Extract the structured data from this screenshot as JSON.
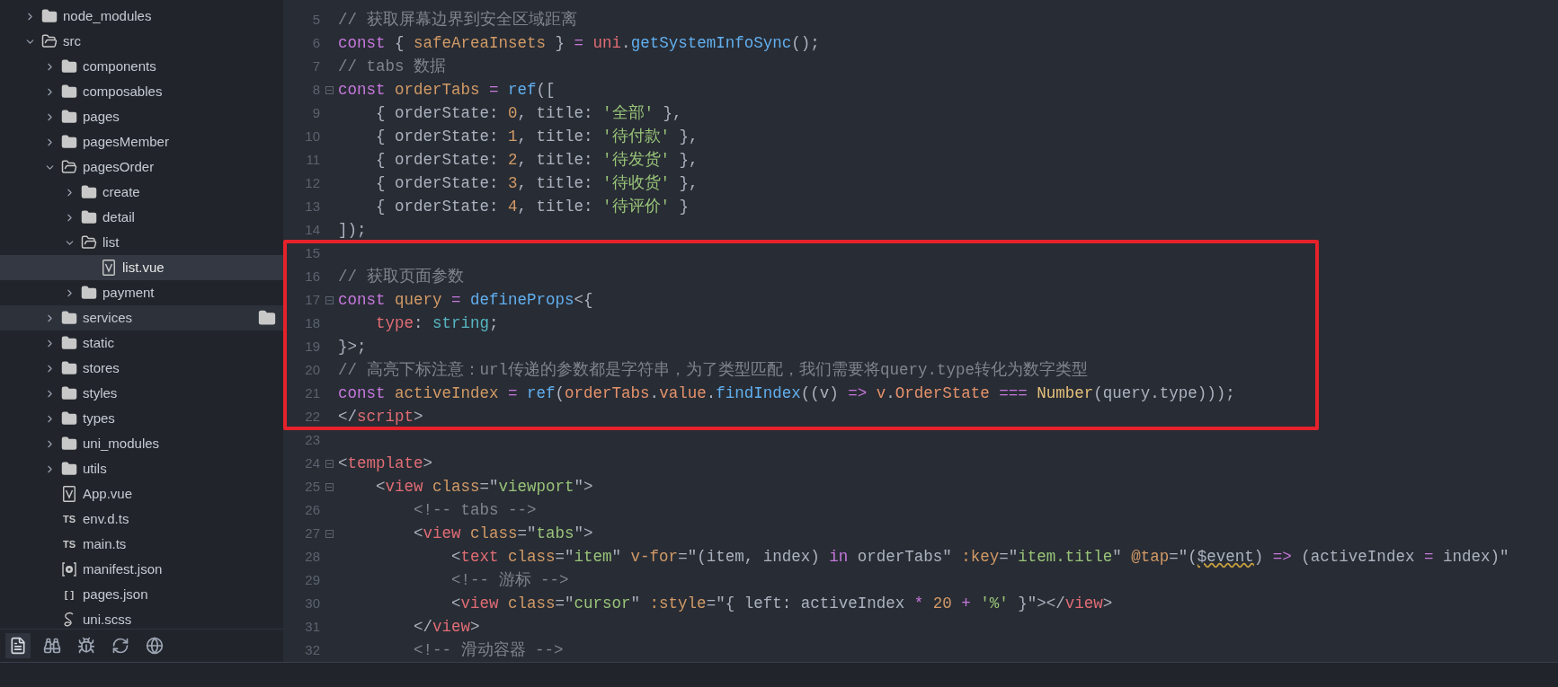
{
  "tree": [
    {
      "kind": "folder",
      "label": "node_modules",
      "expanded": false,
      "selected": false,
      "hovered": false
    },
    {
      "kind": "folder",
      "label": "src",
      "expanded": true,
      "selected": false,
      "hovered": false,
      "children": [
        {
          "kind": "folder",
          "label": "components",
          "expanded": false,
          "selected": false,
          "hovered": false
        },
        {
          "kind": "folder",
          "label": "composables",
          "expanded": false,
          "selected": false,
          "hovered": false
        },
        {
          "kind": "folder",
          "label": "pages",
          "expanded": false,
          "selected": false,
          "hovered": false
        },
        {
          "kind": "folder",
          "label": "pagesMember",
          "expanded": false,
          "selected": false,
          "hovered": false
        },
        {
          "kind": "folder",
          "label": "pagesOrder",
          "expanded": true,
          "selected": false,
          "hovered": false,
          "children": [
            {
              "kind": "folder",
              "label": "create",
              "expanded": false,
              "selected": false,
              "hovered": false
            },
            {
              "kind": "folder",
              "label": "detail",
              "expanded": false,
              "selected": false,
              "hovered": false
            },
            {
              "kind": "folder",
              "label": "list",
              "expanded": true,
              "selected": false,
              "hovered": false,
              "children": [
                {
                  "kind": "vue",
                  "label": "list.vue",
                  "selected": true,
                  "hovered": false
                }
              ]
            },
            {
              "kind": "folder",
              "label": "payment",
              "expanded": false,
              "selected": false,
              "hovered": false
            }
          ]
        },
        {
          "kind": "folder",
          "label": "services",
          "expanded": false,
          "selected": false,
          "hovered": true
        },
        {
          "kind": "folder",
          "label": "static",
          "expanded": false,
          "selected": false,
          "hovered": false
        },
        {
          "kind": "folder",
          "label": "stores",
          "expanded": false,
          "selected": false,
          "hovered": false
        },
        {
          "kind": "folder",
          "label": "styles",
          "expanded": false,
          "selected": false,
          "hovered": false
        },
        {
          "kind": "folder",
          "label": "types",
          "expanded": false,
          "selected": false,
          "hovered": false
        },
        {
          "kind": "folder",
          "label": "uni_modules",
          "expanded": false,
          "selected": false,
          "hovered": false
        },
        {
          "kind": "folder",
          "label": "utils",
          "expanded": false,
          "selected": false,
          "hovered": false
        },
        {
          "kind": "vue",
          "label": "App.vue",
          "selected": false,
          "hovered": false
        },
        {
          "kind": "labelled",
          "icon_text": "TS",
          "label": "env.d.ts",
          "selected": false,
          "hovered": false
        },
        {
          "kind": "labelled",
          "icon_text": "TS",
          "label": "main.ts",
          "selected": false,
          "hovered": false
        },
        {
          "kind": "settings",
          "label": "manifest.json",
          "selected": false,
          "hovered": false
        },
        {
          "kind": "labelled",
          "icon_text": "[ ]",
          "label": "pages.json",
          "selected": false,
          "hovered": false
        },
        {
          "kind": "style",
          "label": "uni.scss",
          "selected": false,
          "hovered": false
        }
      ]
    }
  ],
  "toolbar": [
    {
      "selected": true
    },
    {
      "selected": false
    },
    {
      "selected": false
    },
    {
      "selected": false
    },
    {
      "selected": false
    }
  ],
  "code_blocks": [
    {
      "boxed": false,
      "lines": [
        {
          "number": "5",
          "foldable": false,
          "tokens": [
            {
              "kind": "comment",
              "text": "// 获取屏幕边界到安全区域距离"
            }
          ]
        },
        {
          "number": "6",
          "foldable": false,
          "tokens": [
            {
              "kind": "kw",
              "text": "const"
            },
            {
              "kind": "plain",
              "text": " { "
            },
            {
              "kind": "var",
              "text": "safeAreaInsets"
            },
            {
              "kind": "plain",
              "text": " } "
            },
            {
              "kind": "op",
              "text": "= "
            },
            {
              "kind": "obj",
              "text": "uni"
            },
            {
              "kind": "plain",
              "text": "."
            },
            {
              "kind": "fn",
              "text": "getSystemInfoSync"
            },
            {
              "kind": "plain",
              "text": "();"
            }
          ]
        },
        {
          "number": "7",
          "foldable": false,
          "tokens": [
            {
              "kind": "comment",
              "text": "// tabs 数据"
            }
          ]
        },
        {
          "number": "8",
          "foldable": true,
          "tokens": [
            {
              "kind": "kw",
              "text": "const "
            },
            {
              "kind": "var",
              "text": "orderTabs "
            },
            {
              "kind": "op",
              "text": "= "
            },
            {
              "kind": "fn",
              "text": "ref"
            },
            {
              "kind": "plain",
              "text": "(["
            }
          ]
        },
        {
          "number": "9",
          "foldable": false,
          "tokens": [
            {
              "kind": "plain",
              "text": "    { orderState: "
            },
            {
              "kind": "num",
              "text": "0"
            },
            {
              "kind": "plain",
              "text": ", title: "
            },
            {
              "kind": "str",
              "text": "'全部'"
            },
            {
              "kind": "plain",
              "text": " },"
            }
          ]
        },
        {
          "number": "10",
          "foldable": false,
          "tokens": [
            {
              "kind": "plain",
              "text": "    { orderState: "
            },
            {
              "kind": "num",
              "text": "1"
            },
            {
              "kind": "plain",
              "text": ", title: "
            },
            {
              "kind": "str",
              "text": "'待付款'"
            },
            {
              "kind": "plain",
              "text": " },"
            }
          ]
        },
        {
          "number": "11",
          "foldable": false,
          "tokens": [
            {
              "kind": "plain",
              "text": "    { orderState: "
            },
            {
              "kind": "num",
              "text": "2"
            },
            {
              "kind": "plain",
              "text": ", title: "
            },
            {
              "kind": "str",
              "text": "'待发货'"
            },
            {
              "kind": "plain",
              "text": " },"
            }
          ]
        },
        {
          "number": "12",
          "foldable": false,
          "tokens": [
            {
              "kind": "plain",
              "text": "    { orderState: "
            },
            {
              "kind": "num",
              "text": "3"
            },
            {
              "kind": "plain",
              "text": ", title: "
            },
            {
              "kind": "str",
              "text": "'待收货'"
            },
            {
              "kind": "plain",
              "text": " },"
            }
          ]
        },
        {
          "number": "13",
          "foldable": false,
          "tokens": [
            {
              "kind": "plain",
              "text": "    { orderState: "
            },
            {
              "kind": "num",
              "text": "4"
            },
            {
              "kind": "plain",
              "text": ", title: "
            },
            {
              "kind": "str",
              "text": "'待评价'"
            },
            {
              "kind": "plain",
              "text": " }"
            }
          ]
        },
        {
          "number": "14",
          "foldable": false,
          "tokens": [
            {
              "kind": "plain",
              "text": "]);"
            }
          ]
        }
      ]
    },
    {
      "boxed": true,
      "lines": [
        {
          "number": "15",
          "foldable": false
        },
        {
          "number": "16",
          "foldable": false,
          "tokens": [
            {
              "kind": "comment",
              "text": "// 获取页面参数"
            }
          ]
        },
        {
          "number": "17",
          "foldable": true,
          "tokens": [
            {
              "kind": "kw",
              "text": "const "
            },
            {
              "kind": "var",
              "text": "query "
            },
            {
              "kind": "op",
              "text": "= "
            },
            {
              "kind": "fn",
              "text": "defineProps"
            },
            {
              "kind": "plain",
              "text": "<{"
            }
          ]
        },
        {
          "number": "18",
          "foldable": false,
          "tokens": [
            {
              "kind": "prop",
              "text": "    type"
            },
            {
              "kind": "plain",
              "text": ": "
            },
            {
              "kind": "type",
              "text": "string"
            },
            {
              "kind": "plain",
              "text": ";"
            }
          ]
        },
        {
          "number": "19",
          "foldable": false,
          "tokens": [
            {
              "kind": "plain",
              "text": "}>;"
            }
          ]
        },
        {
          "number": "20",
          "foldable": false,
          "tokens": [
            {
              "kind": "comment",
              "text": "// 高亮下标注意：url传递的参数都是字符串，为了类型匹配，我们需要将query.type转化为数字类型"
            }
          ]
        },
        {
          "number": "21",
          "foldable": false,
          "tokens": [
            {
              "kind": "kw",
              "text": "const "
            },
            {
              "kind": "var",
              "text": "activeIndex "
            },
            {
              "kind": "op",
              "text": "= "
            },
            {
              "kind": "fn",
              "text": "ref"
            },
            {
              "kind": "plain",
              "text": "("
            },
            {
              "kind": "ident",
              "text": "orderTabs"
            },
            {
              "kind": "plain",
              "text": "."
            },
            {
              "kind": "ident",
              "text": "value"
            },
            {
              "kind": "plain",
              "text": "."
            },
            {
              "kind": "fn",
              "text": "findIndex"
            },
            {
              "kind": "plain",
              "text": "((v) "
            },
            {
              "kind": "op",
              "text": "=> "
            },
            {
              "kind": "ident",
              "text": "v"
            },
            {
              "kind": "plain",
              "text": "."
            },
            {
              "kind": "ident",
              "text": "OrderState "
            },
            {
              "kind": "op",
              "text": "=== "
            },
            {
              "kind": "cls",
              "text": "Number"
            },
            {
              "kind": "plain",
              "text": "(query.type)));"
            }
          ]
        },
        {
          "number": "22",
          "foldable": false,
          "tokens": [
            {
              "kind": "plain",
              "text": "</"
            },
            {
              "kind": "tag",
              "text": "script"
            },
            {
              "kind": "plain",
              "text": ">"
            }
          ]
        }
      ]
    },
    {
      "boxed": false,
      "lines": [
        {
          "number": "23",
          "foldable": false
        },
        {
          "number": "24",
          "foldable": true,
          "tokens": [
            {
              "kind": "plain",
              "text": "<"
            },
            {
              "kind": "tag",
              "text": "template"
            },
            {
              "kind": "plain",
              "text": ">"
            }
          ]
        },
        {
          "number": "25",
          "foldable": true,
          "tokens": [
            {
              "kind": "plain",
              "text": "    <"
            },
            {
              "kind": "tag",
              "text": "view "
            },
            {
              "kind": "attr",
              "text": "class"
            },
            {
              "kind": "plain",
              "text": "=\""
            },
            {
              "kind": "str",
              "text": "viewport"
            },
            {
              "kind": "plain",
              "text": "\">"
            }
          ]
        },
        {
          "number": "26",
          "foldable": false,
          "tokens": [
            {
              "kind": "comment",
              "text": "        <!-- tabs -->"
            }
          ]
        },
        {
          "number": "27",
          "foldable": true,
          "tokens": [
            {
              "kind": "plain",
              "text": "        <"
            },
            {
              "kind": "tag",
              "text": "view "
            },
            {
              "kind": "attr",
              "text": "class"
            },
            {
              "kind": "plain",
              "text": "=\""
            },
            {
              "kind": "str",
              "text": "tabs"
            },
            {
              "kind": "plain",
              "text": "\">"
            }
          ]
        },
        {
          "number": "28",
          "foldable": false,
          "tokens": [
            {
              "kind": "plain",
              "text": "            <"
            },
            {
              "kind": "tag",
              "text": "text "
            },
            {
              "kind": "attr",
              "text": "class"
            },
            {
              "kind": "plain",
              "text": "=\""
            },
            {
              "kind": "str",
              "text": "item"
            },
            {
              "kind": "plain",
              "text": "\" "
            },
            {
              "kind": "attr",
              "text": "v-for"
            },
            {
              "kind": "plain",
              "text": "=\"(item, index) "
            },
            {
              "kind": "kw",
              "text": "in"
            },
            {
              "kind": "plain",
              "text": " orderTabs\" "
            },
            {
              "kind": "attr",
              "text": ":key"
            },
            {
              "kind": "plain",
              "text": "=\""
            },
            {
              "kind": "str",
              "text": "item.title"
            },
            {
              "kind": "plain",
              "text": "\" "
            },
            {
              "kind": "attr",
              "text": "@tap"
            },
            {
              "kind": "plain",
              "text": "=\"("
            },
            {
              "kind": "warn",
              "text": "$event"
            },
            {
              "kind": "plain",
              "text": ") "
            },
            {
              "kind": "op",
              "text": "=>"
            },
            {
              "kind": "plain",
              "text": " (activeIndex "
            },
            {
              "kind": "op",
              "text": "="
            },
            {
              "kind": "plain",
              "text": " index)\""
            }
          ]
        },
        {
          "number": "29",
          "foldable": false,
          "tokens": [
            {
              "kind": "comment",
              "text": "            <!-- 游标 -->"
            }
          ]
        },
        {
          "number": "30",
          "foldable": false,
          "tokens": [
            {
              "kind": "plain",
              "text": "            <"
            },
            {
              "kind": "tag",
              "text": "view "
            },
            {
              "kind": "attr",
              "text": "class"
            },
            {
              "kind": "plain",
              "text": "=\""
            },
            {
              "kind": "str",
              "text": "cursor"
            },
            {
              "kind": "plain",
              "text": "\" "
            },
            {
              "kind": "attr",
              "text": ":style"
            },
            {
              "kind": "plain",
              "text": "=\"{ left: activeIndex "
            },
            {
              "kind": "op",
              "text": "* "
            },
            {
              "kind": "num",
              "text": "20 "
            },
            {
              "kind": "op",
              "text": "+ "
            },
            {
              "kind": "str",
              "text": "'%'"
            },
            {
              "kind": "plain",
              "text": " }\"></"
            },
            {
              "kind": "tag",
              "text": "view"
            },
            {
              "kind": "plain",
              "text": ">"
            }
          ]
        },
        {
          "number": "31",
          "foldable": false,
          "tokens": [
            {
              "kind": "plain",
              "text": "        </"
            },
            {
              "kind": "tag",
              "text": "view"
            },
            {
              "kind": "plain",
              "text": ">"
            }
          ]
        },
        {
          "number": "32",
          "foldable": false,
          "tokens": [
            {
              "kind": "comment",
              "text": "        <!-- 滑动容器 -->"
            }
          ]
        }
      ]
    }
  ]
}
